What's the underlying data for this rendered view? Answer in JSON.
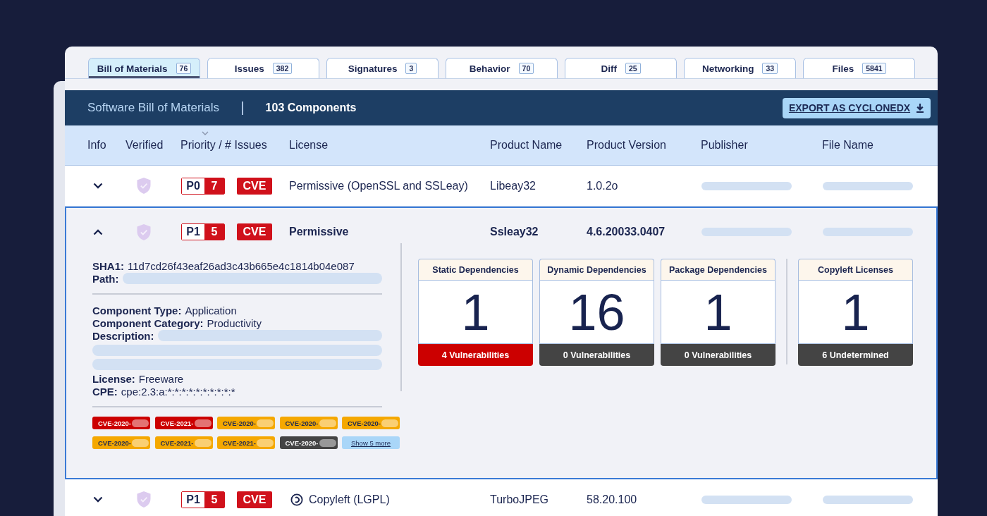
{
  "tabs": [
    {
      "label": "Bill of Materials",
      "count": "76",
      "selected": true
    },
    {
      "label": "Issues",
      "count": "382",
      "selected": false
    },
    {
      "label": "Signatures",
      "count": "3",
      "selected": false
    },
    {
      "label": "Behavior",
      "count": "70",
      "selected": false
    },
    {
      "label": "Diff",
      "count": "25",
      "selected": false
    },
    {
      "label": "Networking",
      "count": "33",
      "selected": false
    },
    {
      "label": "Files",
      "count": "5841",
      "selected": false
    }
  ],
  "header": {
    "title": "Software Bill of Materials",
    "count": "103 Components",
    "export_button": "EXPORT AS CYCLONEDX"
  },
  "table": {
    "columns": [
      {
        "label": "Info",
        "sorted": false
      },
      {
        "label": "Verified",
        "sorted": false
      },
      {
        "label": "Priority / # Issues",
        "sorted": true
      },
      {
        "label": "License",
        "sorted": false
      },
      {
        "label": "Product Name",
        "sorted": false
      },
      {
        "label": "Product Version",
        "sorted": false
      },
      {
        "label": "Publisher",
        "sorted": false
      },
      {
        "label": "File Name",
        "sorted": false
      }
    ],
    "rows": [
      {
        "kind": "permissive",
        "expanded": false,
        "priority": "P0",
        "issues": "7",
        "tag": "CVE",
        "license": "Permissive (OpenSSL and SSLeay)",
        "product_name": "Libeay32",
        "product_version": "1.0.2o"
      },
      {
        "kind": "permissive",
        "expanded": true,
        "priority": "P1",
        "issues": "5",
        "tag": "CVE",
        "license": "Permissive",
        "product_name": "Ssleay32",
        "product_version": "4.6.20033.0407",
        "details": {
          "groups": [
            {
              "fields": [
                {
                  "kind": "text",
                  "label": "SHA1:",
                  "value": "11d7cd26f43eaf26ad3c43b665e4c1814b04e087"
                },
                {
                  "kind": "redacted",
                  "label": "Path:"
                }
              ]
            },
            {
              "fields": [
                {
                  "kind": "text",
                  "label": "Component Type:",
                  "value": "Application"
                },
                {
                  "kind": "text",
                  "label": "Component Category:",
                  "value": "Productivity"
                },
                {
                  "kind": "redacted_paragraph",
                  "label": "Description:"
                },
                {
                  "kind": "text",
                  "label": "License:",
                  "value": "Freeware"
                },
                {
                  "kind": "text",
                  "label": "CPE:",
                  "value": "cpe:2.3:a:*:*:*:*:*:*:*:*:*:*"
                }
              ]
            }
          ],
          "cves": [
            {
              "label": "CVE-2020-",
              "color": "#cc0000"
            },
            {
              "label": "CVE-2021-",
              "color": "#cc0000"
            },
            {
              "label": "CVE-2020-",
              "color": "#f5a800"
            },
            {
              "label": "CVE-2020-",
              "color": "#f5a800"
            },
            {
              "label": "CVE-2020-",
              "color": "#f5a800"
            },
            {
              "label": "CVE-2020-",
              "color": "#f5a800"
            },
            {
              "label": "CVE-2021-",
              "color": "#f5a800"
            },
            {
              "label": "CVE-2021-",
              "color": "#f5a800"
            },
            {
              "label": "CVE-2020-",
              "color": "#444444"
            }
          ],
          "show_more": "Show 5 more",
          "dependency_cards": [
            {
              "title": "Static Dependencies",
              "value": "1",
              "footer": "4 Vulnerabilities",
              "color": "#cc0000"
            },
            {
              "title": "Dynamic Dependencies",
              "value": "16",
              "footer": "0 Vulnerabilities",
              "color": "#444444"
            },
            {
              "title": "Package Dependencies",
              "value": "1",
              "footer": "0 Vulnerabilities",
              "color": "#444444"
            }
          ],
          "license_cards": [
            {
              "title": "Copyleft Licenses",
              "value": "1",
              "footer": "6 Undetermined",
              "color": "#444444"
            }
          ]
        }
      },
      {
        "kind": "copyleft",
        "expanded": false,
        "priority": "P1",
        "issues": "5",
        "tag": "CVE",
        "license": "Copyleft (LGPL)",
        "product_name": "TurboJPEG",
        "product_version": "58.20.100"
      }
    ]
  }
}
